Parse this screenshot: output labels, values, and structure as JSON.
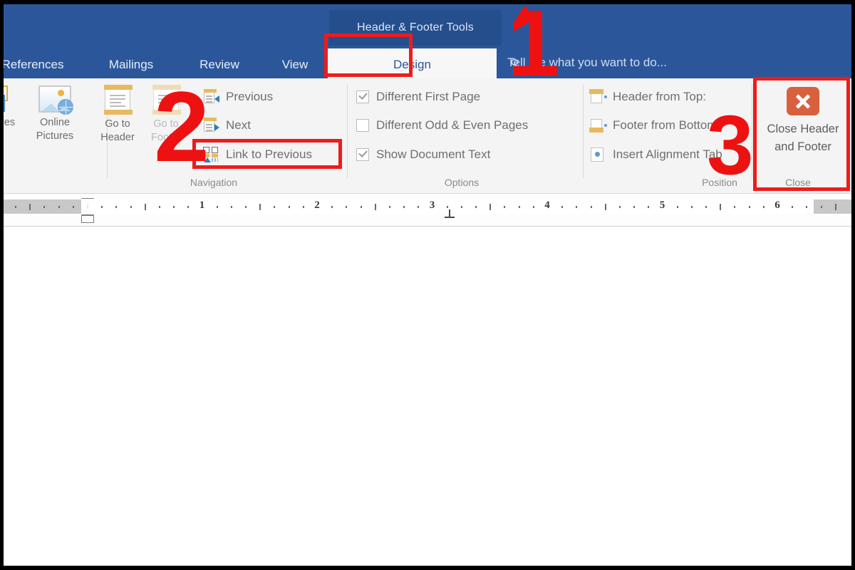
{
  "window": {
    "contextual_tab_label": "Header & Footer Tools",
    "accent_color": "#2b579a",
    "annotation_color": "#ee1b1b"
  },
  "tabs": [
    {
      "label": "References",
      "active": false
    },
    {
      "label": "Mailings",
      "active": false
    },
    {
      "label": "Review",
      "active": false
    },
    {
      "label": "View",
      "active": false
    },
    {
      "label": "Design",
      "active": true
    }
  ],
  "search": {
    "placeholder": "Tell me what you want to do...",
    "icon": "search-icon"
  },
  "ribbon": {
    "groups": [
      {
        "name": "insert-partial",
        "title": "",
        "big_buttons": [
          {
            "label_line1": "res",
            "label_line2": "",
            "icon": "pictures-icon"
          },
          {
            "label_line1": "Online",
            "label_line2": "Pictures",
            "icon": "online-pictures-icon"
          }
        ]
      },
      {
        "name": "navigation",
        "title": "Navigation",
        "big_buttons": [
          {
            "label_line1": "Go to",
            "label_line2": "Header",
            "icon": "go-to-header-icon"
          },
          {
            "label_line1": "Go to",
            "label_line2": "Footer",
            "icon": "go-to-footer-icon"
          }
        ],
        "small_items": [
          {
            "label": "Previous",
            "icon": "previous-section-icon",
            "highlighted": false
          },
          {
            "label": "Next",
            "icon": "next-section-icon",
            "highlighted": false
          },
          {
            "label": "Link to Previous",
            "icon": "link-to-previous-icon",
            "highlighted": true
          }
        ]
      },
      {
        "name": "options",
        "title": "Options",
        "checkboxes": [
          {
            "label": "Different First Page",
            "checked": true
          },
          {
            "label": "Different Odd & Even Pages",
            "checked": false
          },
          {
            "label": "Show Document Text",
            "checked": true
          }
        ]
      },
      {
        "name": "position",
        "title": "Position",
        "small_items": [
          {
            "label": "Header from Top:",
            "icon": "header-from-top-icon"
          },
          {
            "label": "Footer from Bottom:",
            "icon": "footer-from-bottom-icon"
          },
          {
            "label": "Insert Alignment Tab",
            "icon": "insert-alignment-tab-icon"
          }
        ]
      },
      {
        "name": "close",
        "title": "Close",
        "button": {
          "label_line1": "Close Header",
          "label_line2": "and Footer",
          "icon": "close-x-icon",
          "icon_color": "#d9603f"
        }
      }
    ]
  },
  "ruler": {
    "numbers": [
      "1",
      "2",
      "3",
      "4",
      "5",
      "6"
    ],
    "unit": "inches"
  },
  "annotations": [
    {
      "number": "1",
      "target": "design-tab"
    },
    {
      "number": "2",
      "target": "link-to-previous"
    },
    {
      "number": "3",
      "target": "close-header-and-footer"
    }
  ]
}
